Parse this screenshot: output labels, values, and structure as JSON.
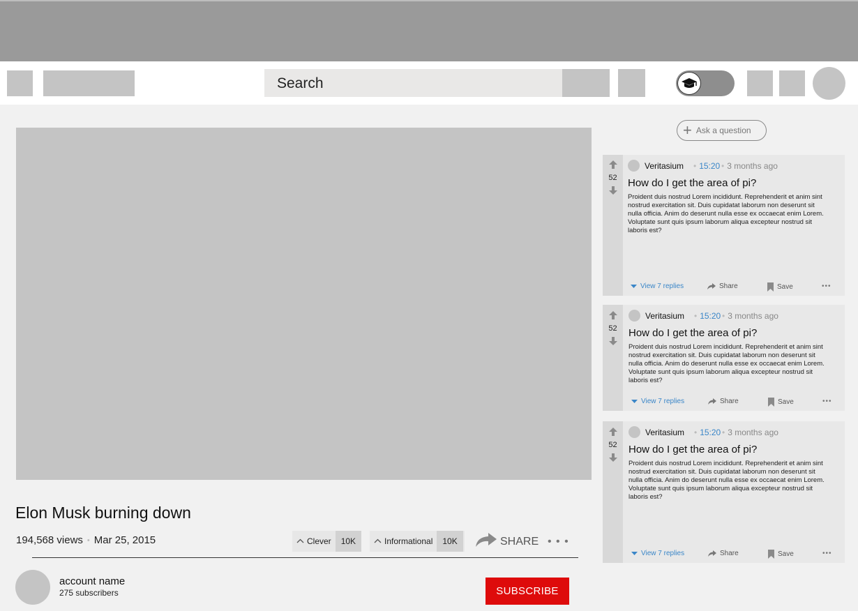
{
  "header": {
    "search_placeholder": "Search"
  },
  "video": {
    "title": "Elon Musk burning down",
    "views": "194,568 views",
    "date": "Mar 25, 2015",
    "tags": [
      {
        "label": "Clever",
        "count": "10K"
      },
      {
        "label": "Informational",
        "count": "10K"
      }
    ],
    "share_label": "SHARE",
    "more_label": "• • •"
  },
  "channel": {
    "name": "account name",
    "subscribers": "275 subscribers",
    "subscribe_label": "SUBSCRIBE"
  },
  "questions": {
    "ask_label": "Ask a question",
    "items": [
      {
        "votes": "52",
        "author": "Veritasium",
        "timestamp": "15:20",
        "ago": "3 months ago",
        "title": "How do I get the area of pi?",
        "body": "Proident duis nostrud Lorem incididunt. Reprehenderit et anim sint nostrud exercitation sit. Duis cupidatat laborum non deserunt sit nulla officia. Anim do deserunt nulla esse ex occaecat enim Lorem. Voluptate sunt quis ipsum laborum aliqua excepteur nostrud sit laboris est?",
        "replies_label": "View 7 replies",
        "share_label": "Share",
        "save_label": "Save",
        "more_label": "•••"
      },
      {
        "votes": "52",
        "author": "Veritasium",
        "timestamp": "15:20",
        "ago": "3 months ago",
        "title": "How do I get the area of pi?",
        "body": "Proident duis nostrud Lorem incididunt. Reprehenderit et anim sint nostrud exercitation sit. Duis cupidatat laborum non deserunt sit nulla officia. Anim do deserunt nulla esse ex occaecat enim Lorem. Voluptate sunt quis ipsum laborum aliqua excepteur nostrud sit laboris est?",
        "replies_label": "View 7 replies",
        "share_label": "Share",
        "save_label": "Save",
        "more_label": "•••"
      },
      {
        "votes": "52",
        "author": "Veritasium",
        "timestamp": "15:20",
        "ago": "3 months ago",
        "title": "How do I get the area of pi?",
        "body": "Proident duis nostrud Lorem incididunt. Reprehenderit et anim sint nostrud exercitation sit. Duis cupidatat laborum non deserunt sit nulla officia. Anim do deserunt nulla esse ex occaecat enim Lorem. Voluptate sunt quis ipsum laborum aliqua excepteur nostrud sit laboris est?",
        "replies_label": "View 7 replies",
        "share_label": "Share",
        "save_label": "Save",
        "more_label": "•••"
      }
    ]
  },
  "colors": {
    "accent_link": "#3a86c8",
    "subscribe": "#de0b0b",
    "placeholder": "#c4c4c4"
  },
  "icons": [
    "menu-icon",
    "graduation-cap-icon",
    "arrow-up-icon",
    "arrow-down-icon",
    "share-arrow-icon",
    "bookmark-icon",
    "plus-icon",
    "caret-down-icon"
  ]
}
